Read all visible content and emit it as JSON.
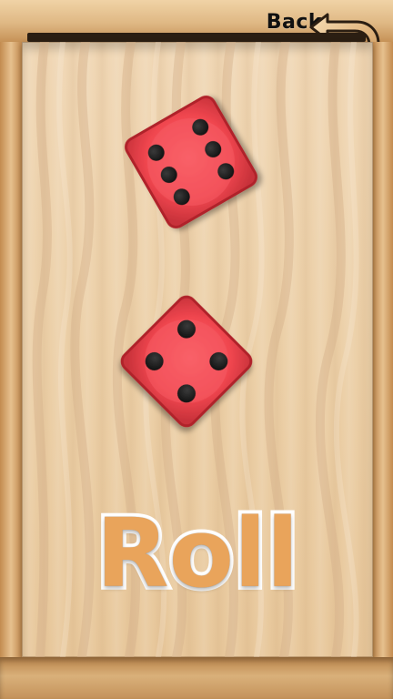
{
  "header": {
    "back_label": "Back"
  },
  "dice": [
    {
      "name": "die-1",
      "value": 6
    },
    {
      "name": "die-2",
      "value": 4
    }
  ],
  "actions": {
    "roll_label": "Roll"
  },
  "colors": {
    "die_red": "#f0464f",
    "die_red_dark": "#c8323a",
    "pip_black": "#1a1a1a",
    "wood_light": "#f0d7b5",
    "wood_mid": "#d9b07a",
    "roll_orange": "#e9a45b"
  },
  "icons": {
    "back": "back-arrow-icon"
  }
}
